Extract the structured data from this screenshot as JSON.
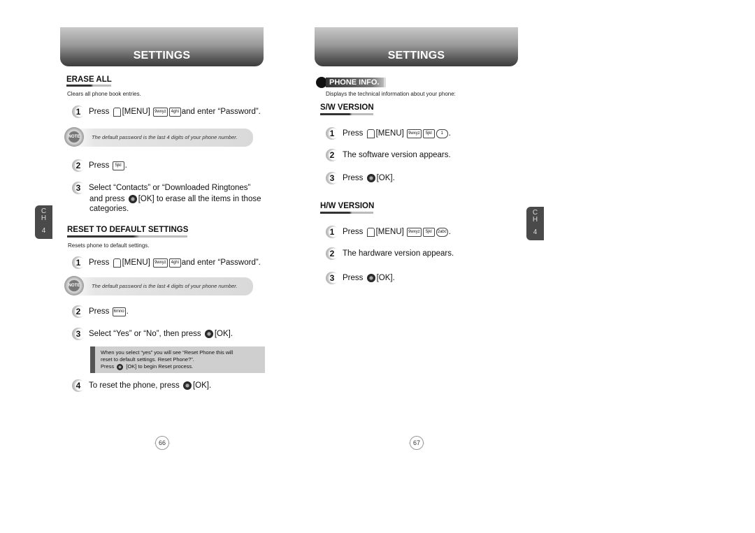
{
  "left_page": {
    "header_title": "SETTINGS",
    "erase_all": {
      "title": "ERASE ALL",
      "description": "Clears all phone book entries.",
      "steps": [
        {
          "num": "1",
          "pre": "Press",
          "menu": "[MENU]",
          "keys": [
            "9wxyz",
            "4ghi"
          ],
          "post": "and enter “Password”."
        },
        {
          "num": "2",
          "pre": "Press",
          "keys": [
            "5jkl"
          ],
          "post": "."
        },
        {
          "num": "3",
          "line1": "Select “Contacts” or “Downloaded Ringtones”",
          "line2_pre": "and press",
          "line2_post": "[OK] to erase all the items in those",
          "line3": "categories."
        }
      ],
      "note": {
        "icon_label": "NOTE",
        "text": "The default password is the last 4 digits of your phone number."
      }
    },
    "reset": {
      "title": "RESET TO DEFAULT SETTINGS",
      "description": "Resets phone to default settings.",
      "steps": [
        {
          "num": "1",
          "pre": "Press",
          "menu": "[MENU]",
          "keys": [
            "9wxyz",
            "4ghi"
          ],
          "post": "and enter “Password”."
        },
        {
          "num": "2",
          "pre": "Press",
          "keys": [
            "6mno"
          ],
          "post": "."
        },
        {
          "num": "3",
          "pre": "Select “Yes” or “No”, then press",
          "post": "[OK]."
        },
        {
          "num": "4",
          "pre": "To reset the phone, press",
          "post": "[OK]."
        }
      ],
      "note": {
        "icon_label": "NOTE",
        "text": "The default password is the last 4 digits of your phone number."
      },
      "callout": {
        "line1": "When you select “yes” you will see “Reset Phone this will",
        "line2": "reset to default settings. Reset Phone?”.",
        "line3_pre": "Press",
        "line3_post": "[OK] to begin Reset process."
      }
    },
    "chapter_tab": {
      "c": "C",
      "h": "H",
      "n": "4"
    },
    "page_number": "66"
  },
  "right_page": {
    "header_title": "SETTINGS",
    "section_label": "PHONE INFO.",
    "description": "Displays the technical information about your phone:",
    "sw_version": {
      "title": "S/W VERSION",
      "steps": [
        {
          "num": "1",
          "pre": "Press",
          "menu": "[MENU]",
          "keys": [
            "9wxyz",
            "5jkl",
            "1"
          ],
          "post": "."
        },
        {
          "num": "2",
          "text": "The software version appears."
        },
        {
          "num": "3",
          "pre": "Press",
          "post": "[OK]."
        }
      ]
    },
    "hw_version": {
      "title": "H/W VERSION",
      "steps": [
        {
          "num": "1",
          "pre": "Press",
          "menu": "[MENU]",
          "keys": [
            "9wxyz",
            "5jkl",
            "2abc"
          ],
          "post": "."
        },
        {
          "num": "2",
          "text": "The hardware version appears."
        },
        {
          "num": "3",
          "pre": "Press",
          "post": "[OK]."
        }
      ]
    },
    "chapter_tab": {
      "c": "C",
      "h": "H",
      "n": "4"
    },
    "page_number": "67"
  }
}
